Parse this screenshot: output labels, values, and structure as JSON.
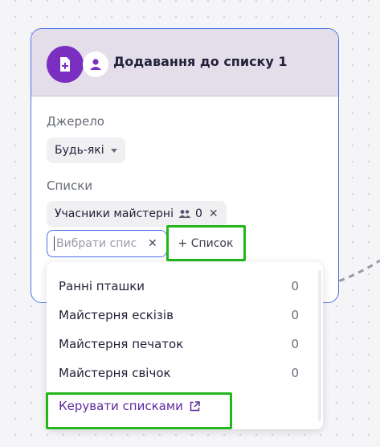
{
  "node": {
    "title": "Додавання до списку 1",
    "icons": [
      "list-add-icon",
      "user-icon"
    ]
  },
  "source": {
    "label": "Джерело",
    "selected": "Будь-які"
  },
  "lists": {
    "label": "Списки",
    "selected_chip": {
      "name": "Учасники майстерні",
      "count": "0",
      "icon": "people-icon"
    },
    "search": {
      "value": "",
      "placeholder": "Вибрати спис"
    },
    "add_button": "+ Список"
  },
  "dropdown": {
    "items": [
      {
        "name": "Ранні пташки",
        "count": "0"
      },
      {
        "name": "Майстерня ескізів",
        "count": "0"
      },
      {
        "name": "Майстерня печаток",
        "count": "0"
      },
      {
        "name": "Майстерня свічок",
        "count": "0"
      }
    ],
    "manage_link": "Керувати списками"
  },
  "colors": {
    "accent": "#4a74e8",
    "highlight": "#22b81c",
    "node_icon": "#7b2fc0",
    "header_bg": "#e4ddea",
    "link": "#5e2a9c"
  }
}
